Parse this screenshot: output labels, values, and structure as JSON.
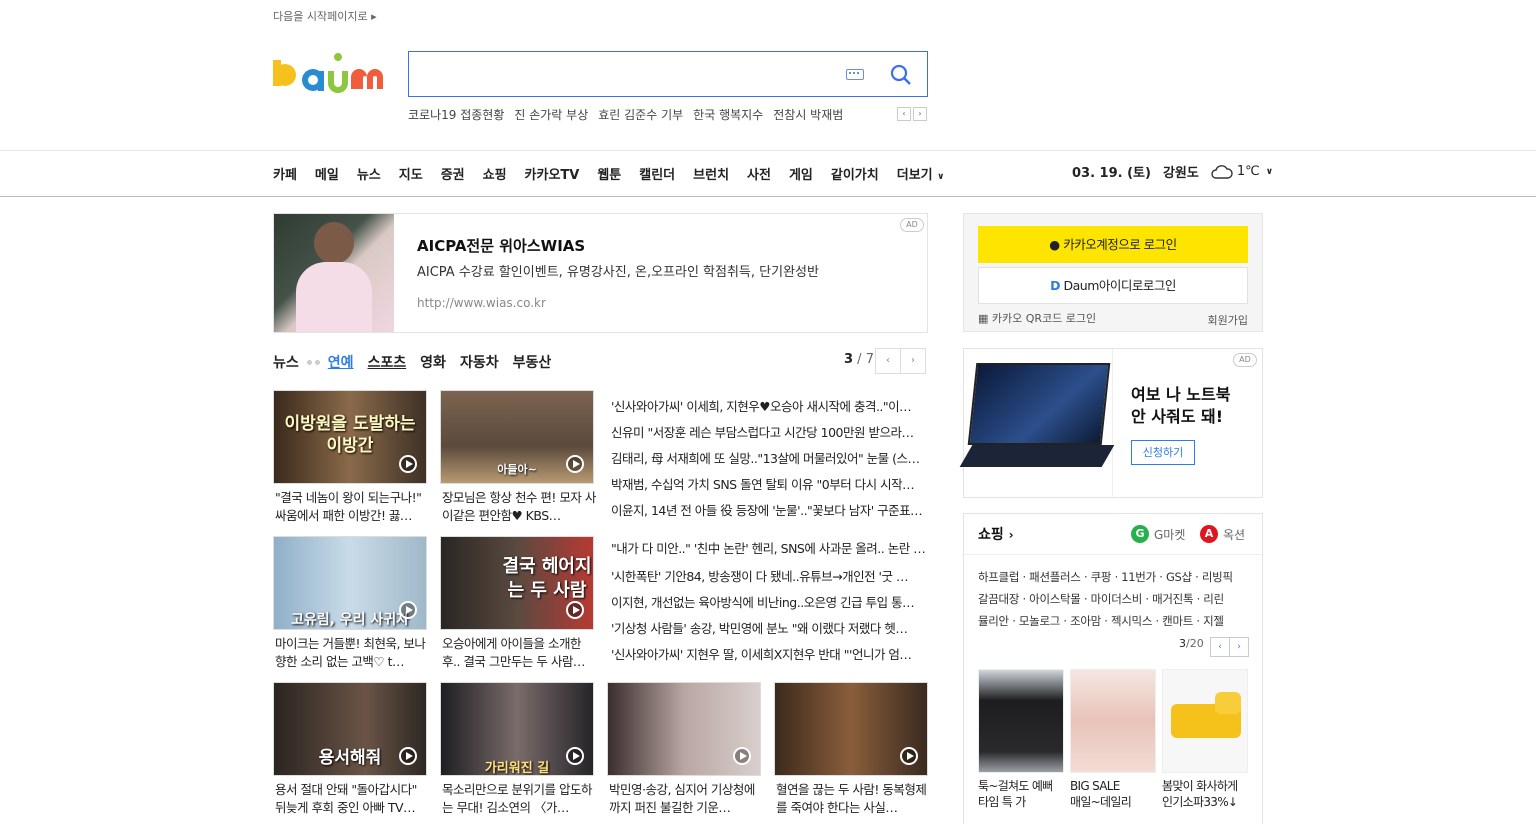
{
  "header": {
    "start_page": "다음을 시작페이지로",
    "search_placeholder": "",
    "trending": [
      "코로나19 접종현황",
      "진 손가락 부상",
      "효린 김준수 기부",
      "한국 행복지수",
      "전참시 박재범"
    ]
  },
  "gnb": {
    "items": [
      "카페",
      "메일",
      "뉴스",
      "지도",
      "증권",
      "쇼핑",
      "카카오TV",
      "웹툰",
      "캘린더",
      "브런치",
      "사전",
      "게임",
      "같이가치",
      "더보기"
    ],
    "date": "03. 19. (토)",
    "region": "강원도",
    "temp": "1℃"
  },
  "ad_top": {
    "badge": "AD",
    "title": "AICPA전문 위아스WIAS",
    "desc": "AICPA 수강료 할인이벤트, 유명강사진, 온,오프라인 학점취득, 단기완성반",
    "url": "http://www.wias.co.kr"
  },
  "tabs": {
    "items": [
      "뉴스",
      "연예",
      "스포츠",
      "영화",
      "자동차",
      "부동산"
    ],
    "active": "연예",
    "page_current": "3",
    "page_total": " / 7"
  },
  "media": [
    {
      "caption": "\"결국 네놈이 왕이 되는구나!\" 싸움에서 패한 이방간! 끓…",
      "overlay": "이방원을 도발하는 이방간"
    },
    {
      "caption": "장모님은 항상 천수 편! 모자 사이같은 편안함♥ KBS…",
      "overlay": "아들아~"
    },
    {
      "caption": "마이크는 거들뿐! 최현욱, 보나 향한 소리 없는 고백♡ t…",
      "overlay": "고유림, 우리 사귀자"
    },
    {
      "caption": "오승아에게 아이들을 소개한 후.. 결국 그만두는 두 사람…",
      "overlay": "결국 헤어지는 두 사람"
    },
    {
      "caption": "용서 절대 안돼 \"돌아갑시다\" 뒤늦게 후회 중인 아빠 TV…",
      "overlay": "용서해줘"
    },
    {
      "caption": "목소리만으로 분위기를 압도하는 무대! 김소연의 〈가…",
      "overlay": "가리워진 길"
    },
    {
      "caption": "박민영·송강, 심지어 기상청에까지 퍼진 불길한 기운…",
      "overlay": ""
    },
    {
      "caption": "혈연을 끊는 두 사람! 동복형제를 죽여야 한다는 사실…",
      "overlay": ""
    }
  ],
  "headlines": [
    "'신사와아가씨' 이세희, 지현우♥오승아 새시작에 충격..\"이…",
    "신유미 \"서장훈 레슨 부담스럽다고 시간당 100만원 받으라…",
    "김태리, 母 서재희에 또 실망..\"13살에 머물러있어\" 눈물 (스…",
    "박재범, 수십억 가치 SNS 돌연 탈퇴 이유 \"0부터 다시 시작…",
    "이윤지, 14년 전 아들 役 등장에 '눈물'..\"꽃보다 남자' 구준표…",
    "\"내가 다 미안..\" '친中 논란' 헨리, SNS에 사과문 올려.. 논란 …",
    "'시한폭탄' 기안84, 방송쟁이 다 됐네..유튜브→개인전 '굿 …",
    "이지현, 개선없는 육아방식에 비난ing..오은영 긴급 투입 통…",
    "'기상청 사람들' 송강, 박민영에 분노 \"왜 이랬다 저랬다 헷…",
    "'신사와아가씨' 지현우 딸, 이세희X지현우 반대 \"'언니가 엄…"
  ],
  "login": {
    "kakao": "카카오계정으로 로그인",
    "daum": "Daum아이디로로그인",
    "qr": "카카오 QR코드 로그인",
    "join": "회원가입"
  },
  "ad_side": {
    "badge": "AD",
    "title_l1": "여보 나 노트북",
    "title_l2": "안 사줘도 돼!",
    "button": "신청하기"
  },
  "shopping": {
    "title": "쇼핑",
    "gmarket": "G마켓",
    "auction": "옥션",
    "links": [
      "하프클럽 · 패션플러스 · 쿠팡 · 11번가 · GS샵 · 리빙픽",
      "갈끔대장 · 아이스탁몰 · 마이더스비 · 매거진톡 · 리린",
      "뮬리안 · 모놀로그 · 조아맘 · 젝시믹스 · 캔마트 · 지젤"
    ],
    "page_current": "3",
    "page_total": "/20",
    "products": [
      {
        "l1": "툭~걸쳐도 예뻐",
        "l2": "타임 특 가"
      },
      {
        "l1": "BIG SALE",
        "l2": "매일~데일리"
      },
      {
        "l1": "봄맞이 화사하게",
        "l2": "인기소파33%↓"
      }
    ]
  },
  "colors": {
    "accent": "#2b7de9",
    "kakao": "#fee500",
    "search_border": "#3d6ef0"
  }
}
